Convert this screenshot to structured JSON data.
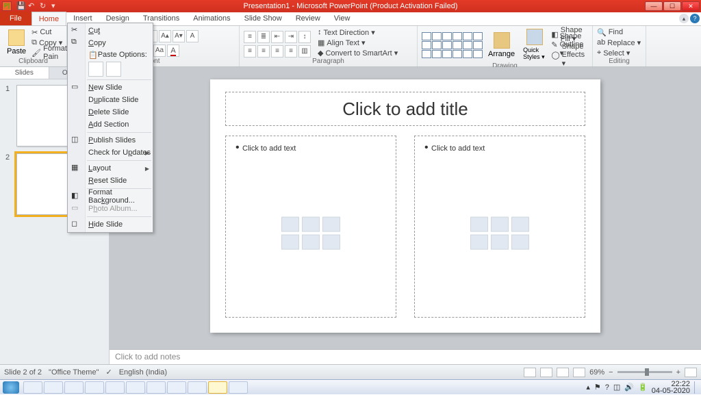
{
  "titlebar": {
    "app_icon": "P]",
    "title": "Presentation1 - Microsoft PowerPoint (Product Activation Failed)"
  },
  "ribbon_tabs": {
    "file": "File",
    "tabs": [
      "Home",
      "Insert",
      "Design",
      "Transitions",
      "Animations",
      "Slide Show",
      "Review",
      "View"
    ],
    "active": "Home"
  },
  "ribbon": {
    "clipboard": {
      "label": "Clipboard",
      "paste": "Paste",
      "cut": "Cut",
      "copy": "Copy ▾",
      "format_painter": "Format Pain"
    },
    "font": {
      "label": "Font"
    },
    "paragraph": {
      "label": "Paragraph",
      "text_direction": "Text Direction ▾",
      "align_text": "Align Text ▾",
      "convert_smartart": "Convert to SmartArt ▾"
    },
    "drawing": {
      "label": "Drawing",
      "arrange": "Arrange",
      "quick_styles": "Quick Styles ▾",
      "shape_fill": "Shape Fill ▾",
      "shape_outline": "Shape Outline ▾",
      "shape_effects": "Shape Effects ▾"
    },
    "editing": {
      "label": "Editing",
      "find": "Find",
      "replace": "Replace ▾",
      "select": "Select ▾"
    }
  },
  "context_menu": {
    "cut": "Cut",
    "copy": "Copy",
    "paste_options": "Paste Options:",
    "new_slide": "New Slide",
    "duplicate_slide": "Duplicate Slide",
    "delete_slide": "Delete Slide",
    "add_section": "Add Section",
    "publish_slides": "Publish Slides",
    "check_updates": "Check for Updates",
    "layout": "Layout",
    "reset_slide": "Reset Slide",
    "format_background": "Format Background...",
    "photo_album": "Photo Album...",
    "hide_slide": "Hide Slide"
  },
  "left_pane": {
    "tabs": {
      "slides": "Slides",
      "outline": "Outline"
    },
    "thumbs": [
      {
        "num": "1"
      },
      {
        "num": "2"
      }
    ]
  },
  "slide": {
    "title_placeholder": "Click to add title",
    "content_placeholder": "Click to add text"
  },
  "notes": {
    "placeholder": "Click to add notes"
  },
  "statusbar": {
    "slide_info": "Slide 2 of 2",
    "theme": "\"Office Theme\"",
    "language": "English (India)",
    "zoom": "69%"
  },
  "taskbar": {
    "time": "22:22",
    "date": "04-05-2020"
  }
}
